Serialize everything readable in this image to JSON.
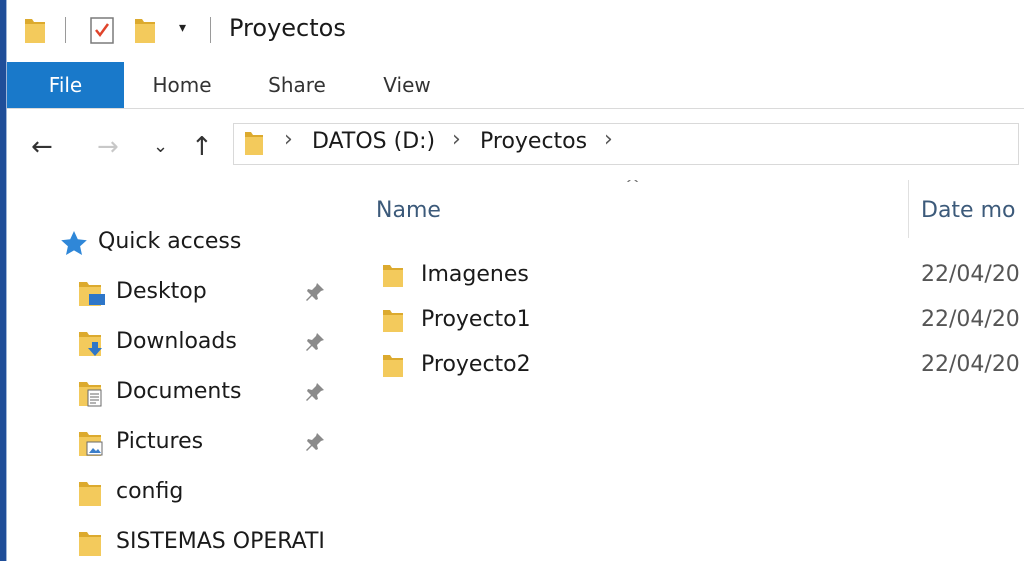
{
  "window": {
    "title": "Proyectos"
  },
  "ribbon": {
    "tabs": [
      {
        "label": "File"
      },
      {
        "label": "Home"
      },
      {
        "label": "Share"
      },
      {
        "label": "View"
      }
    ]
  },
  "address": {
    "crumbs": [
      "DATOS (D:)",
      "Proyectos"
    ]
  },
  "navpane": {
    "quick_access": "Quick access",
    "items": [
      {
        "label": "Desktop",
        "icon": "desktop-folder-icon",
        "pinned": true
      },
      {
        "label": "Downloads",
        "icon": "downloads-folder-icon",
        "pinned": true
      },
      {
        "label": "Documents",
        "icon": "documents-folder-icon",
        "pinned": true
      },
      {
        "label": "Pictures",
        "icon": "pictures-folder-icon",
        "pinned": true
      },
      {
        "label": "config",
        "icon": "folder-icon",
        "pinned": false
      },
      {
        "label": "SISTEMAS OPERATI",
        "icon": "folder-icon",
        "pinned": false
      }
    ]
  },
  "content": {
    "columns": {
      "name": "Name",
      "date": "Date mo"
    },
    "rows": [
      {
        "name": "Imagenes",
        "date": "22/04/20"
      },
      {
        "name": "Proyecto1",
        "date": "22/04/20"
      },
      {
        "name": "Proyecto2",
        "date": "22/04/20"
      }
    ]
  },
  "colors": {
    "accent": "#1979ca",
    "folder": "#f1c75a",
    "folder_dark": "#dcaa2e",
    "border": "#1f4e99"
  }
}
